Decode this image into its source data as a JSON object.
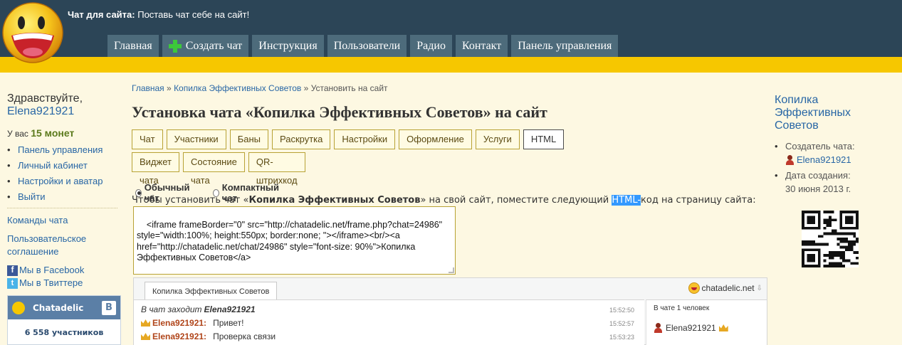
{
  "header": {
    "tagline_bold": "Чат для сайта:",
    "tagline_text": "Поставь чат себе на сайт!",
    "nav": [
      {
        "label": "Главная"
      },
      {
        "label": "Создать чат"
      },
      {
        "label": "Инструкция"
      },
      {
        "label": "Пользователи"
      },
      {
        "label": "Радио"
      },
      {
        "label": "Контакт"
      },
      {
        "label": "Панель управления"
      }
    ]
  },
  "left": {
    "greeting": "Здравствуйте,",
    "username": "Elena921921",
    "coins_prefix": "У вас",
    "coins_value": "15 монет",
    "menu": [
      "Панель управления",
      "Личный кабинет",
      "Настройки и аватар",
      "Выйти"
    ],
    "links": [
      "Команды чата",
      "Пользовательское соглашение"
    ],
    "facebook": "Мы в Facebook",
    "twitter": "Мы в Твиттере",
    "vk": {
      "title": "Chatadelic",
      "badge": "В",
      "count": "6 558 участников"
    }
  },
  "main": {
    "breadcrumb": [
      "Главная",
      "Копилка Эффективных Советов",
      "Установить на сайт"
    ],
    "breadcrumb_sep": "»",
    "title": "Установка чата «Копилка Эффективных Советов» на сайт",
    "tabs_row1": [
      "Чат",
      "Участники",
      "Баны",
      "Раскрутка",
      "Настройки",
      "Оформление",
      "Услуги",
      "HTML"
    ],
    "tabs_row2": [
      "Виджет чата",
      "Состояние чата",
      "QR-штрихкод"
    ],
    "radio_normal": "Обычный чат",
    "radio_compact": "Компактный чат",
    "instr_1": "Чтобы установить чат «",
    "instr_chat": "Копилка Эффективных Советов",
    "instr_2": "» на свой сайт, поместите следующий ",
    "instr_hl": "HTML-",
    "instr_3": "код на страницу сайта:",
    "code": "<iframe frameBorder=\"0\" src=\"http://chatadelic.net/frame.php?chat=24986\" style=\"width:100%; height:550px; border:none; \"></iframe><br/><a href=\"http://chatadelic.net/chat/24986\" style=\"font-size: 90%\">Копилка Эффективных Советов</a>"
  },
  "chat_preview": {
    "tab": "Копилка Эффективных Советов",
    "brand": "chatadelic.net",
    "messages": [
      {
        "type": "system",
        "text": "В чат заходит",
        "nick": "Elena921921",
        "time": "15:52:50"
      },
      {
        "type": "msg",
        "nick": "Elena921921:",
        "text": "Привет!",
        "time": "15:52:57"
      },
      {
        "type": "msg",
        "nick": "Elena921921:",
        "text": "Проверка связи",
        "time": "15:53:23"
      }
    ],
    "users_title": "В чате 1 человек",
    "user": "Elena921921"
  },
  "right": {
    "title": "Копилка Эффективных Советов",
    "creator_label": "Создатель чата:",
    "creator": "Elena921921",
    "date_label": "Дата создания:",
    "date": "30 июня 2013 г."
  }
}
